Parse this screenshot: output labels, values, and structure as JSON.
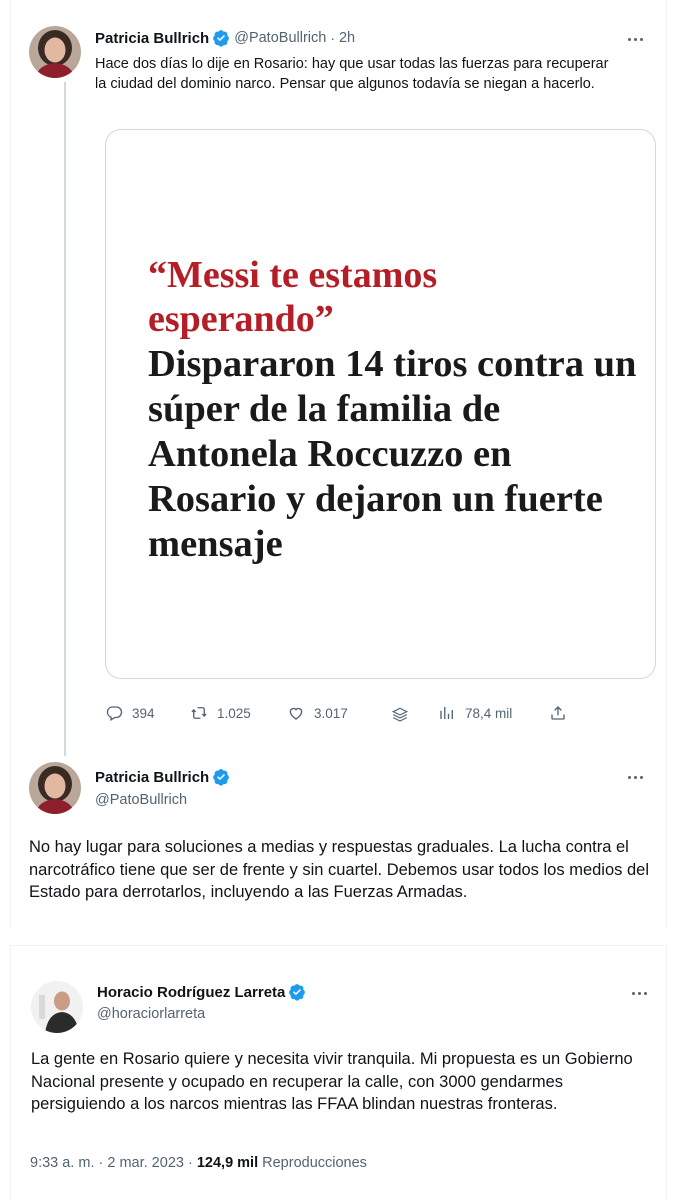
{
  "tweet1": {
    "author_name": "Patricia Bullrich",
    "handle": "@PatoBullrich",
    "separator": "·",
    "time": "2h",
    "text": "Hace dos días lo dije en Rosario: hay que usar todas las fuerzas para recuperar la ciudad del dominio narco. Pensar que algunos todavía se niegan a hacerlo.",
    "card": {
      "headline_red": "“Messi te estamos esperando”",
      "headline_black": "Dispararon 14 tiros contra un súper de la familia de Antonela Roccuzzo en Rosario y dejaron un fuerte mensaje"
    },
    "actions": {
      "replies": "394",
      "retweets": "1.025",
      "likes": "3.017",
      "views": "78,4 mil"
    }
  },
  "tweet2": {
    "author_name": "Patricia Bullrich",
    "handle": "@PatoBullrich",
    "text": "No hay lugar para soluciones a medias y respuestas graduales. La lucha contra el narcotráfico tiene que ser de frente y sin cuartel. Debemos usar todos los medios del Estado para derrotarlos, incluyendo a las Fuerzas Armadas."
  },
  "tweet3": {
    "author_name": "Horacio Rodríguez Larreta",
    "handle": "@horaciorlarreta",
    "text": "La gente en Rosario quiere y necesita vivir tranquila. Mi propuesta es un Gobierno Nacional presente y ocupado en recuperar la calle, con 3000 gendarmes persiguiendo a los narcos mientras las FFAA blindan nuestras fronteras.",
    "timestamp": "9:33 a. m. · 2 mar. 2023 ·",
    "views_count": "124,9 mil",
    "views_label": "Reproducciones"
  },
  "colors": {
    "verified": "#1d9bf0",
    "secondary_text": "#536471",
    "headline_red": "#b41e26"
  },
  "icons": [
    "reply-icon",
    "retweet-icon",
    "like-icon",
    "layers-icon",
    "views-icon",
    "share-icon",
    "verified-icon",
    "more-icon"
  ]
}
